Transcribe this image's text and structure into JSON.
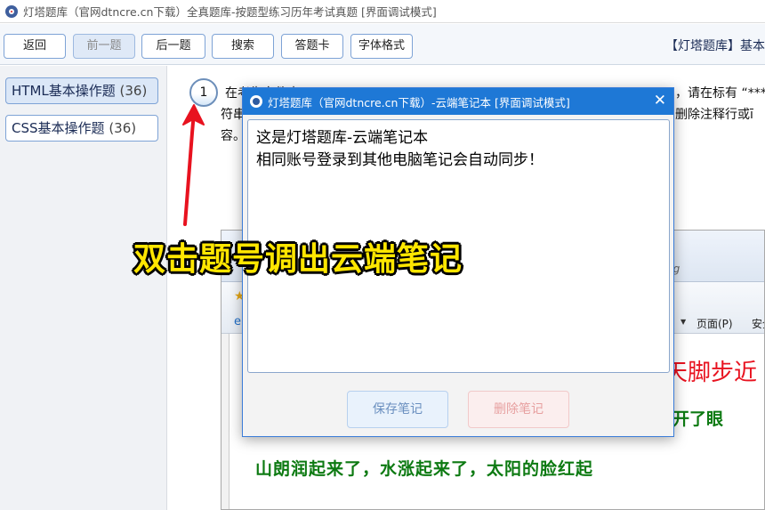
{
  "window": {
    "title": "灯塔题库（官网dtncre.cn下载）全真题库-按题型练习历年考试真题 [界面调试模式]",
    "app_icon": "lighthouse-logo-icon"
  },
  "toolbar": {
    "back_label": "返回",
    "prev_label": "前一题",
    "next_label": "后一题",
    "search_label": "搜索",
    "answer_card_label": "答题卡",
    "font_label": "字体格式",
    "bank_title": "【灯塔题库】基本"
  },
  "sidebar": {
    "items": [
      {
        "label": "HTML基本操作题",
        "count": "(36)",
        "active": true
      },
      {
        "label": "CSS基本操作题",
        "count": "(36)",
        "active": false
      }
    ]
  },
  "question": {
    "number": "1",
    "line1_start": "在考生文件夹下",
    "line1_end": "，请在标有 “*********",
    "line2_start": "符串",
    "line2_end": "删除注释行或ī",
    "line3": "容。"
  },
  "annotation": {
    "caption": "双击题号调出云端笔记",
    "arrow_color": "#e8121f"
  },
  "embedded_browser": {
    "address_hint": "ng",
    "page_menu": "页面(P)",
    "safety_menu": "安全",
    "red_text": "天脚步近",
    "green_text_1": "张开了眼",
    "green_text_2": "山朗润起来了，水涨起来了，太阳的脸红起"
  },
  "notes_dialog": {
    "title": "灯塔题库（官网dtncre.cn下载）-云端笔记本 [界面调试模式]",
    "close_icon": "close-icon",
    "content_line1": "这是灯塔题库-云端笔记本",
    "content_line2": "相同账号登录到其他电脑笔记会自动同步！",
    "save_label": "保存笔记",
    "delete_label": "删除笔记"
  }
}
